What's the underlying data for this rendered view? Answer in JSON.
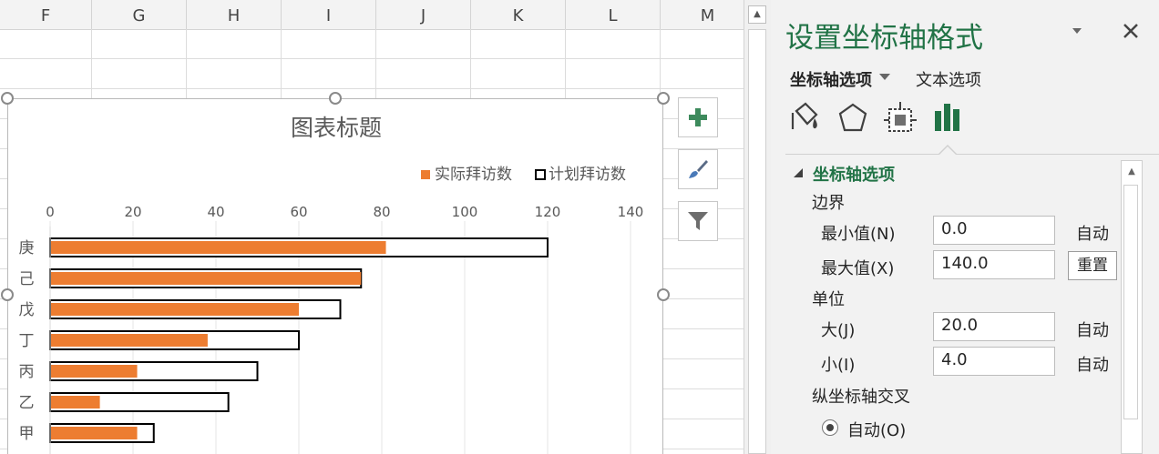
{
  "sheet": {
    "columns": [
      "F",
      "G",
      "H",
      "I",
      "J",
      "K",
      "L",
      "M"
    ]
  },
  "chart_data": {
    "type": "bar",
    "title": "图表标题",
    "categories": [
      "甲",
      "乙",
      "丙",
      "丁",
      "戊",
      "己",
      "庚"
    ],
    "series": [
      {
        "name": "实际拜访数",
        "values": [
          21,
          12,
          21,
          38,
          60,
          75,
          81
        ],
        "style": "filled",
        "color": "#ed7d31"
      },
      {
        "name": "计划拜访数",
        "values": [
          25,
          43,
          50,
          60,
          70,
          75,
          120
        ],
        "style": "outline",
        "color": "#000000"
      }
    ],
    "x_ticks": [
      "0",
      "20",
      "40",
      "60",
      "80",
      "100",
      "120",
      "140"
    ],
    "xlim": [
      0,
      140
    ],
    "x_axis_position": "top",
    "category_order": "reversed",
    "legend_position": "top-right"
  },
  "chart_buttons": {
    "add_icon": "plus-icon",
    "style_icon": "brush-icon",
    "filter_icon": "filter-icon"
  },
  "pane": {
    "title": "设置坐标轴格式",
    "tab_axis_options": "坐标轴选项",
    "tab_text_options": "文本选项",
    "icons": [
      "fill-line-icon",
      "effects-icon",
      "size-properties-icon",
      "axis-options-icon"
    ],
    "section": "坐标轴选项",
    "bounds_group": "边界",
    "min_label": "最小值(N)",
    "min_value": "0.0",
    "min_auto": "自动",
    "max_label": "最大值(X)",
    "max_value": "140.0",
    "reset_label": "重置",
    "units_group": "单位",
    "major_label": "大(J)",
    "major_value": "20.0",
    "major_auto": "自动",
    "minor_label": "小(I)",
    "minor_value": "4.0",
    "minor_auto": "自动",
    "cross_group": "纵坐标轴交叉",
    "cross_auto_label": "自动(O)",
    "accent_color": "#217346"
  }
}
